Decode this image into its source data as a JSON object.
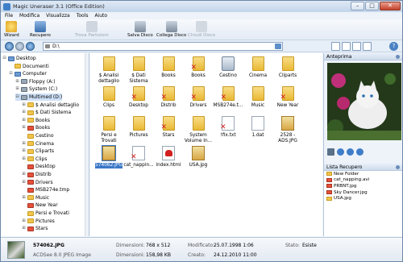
{
  "window": {
    "title": "Magic Uneraser 3.1 (Office Edition)"
  },
  "menu": [
    "File",
    "Modifica",
    "Visualizza",
    "Tools",
    "Aiuto"
  ],
  "toolbar": {
    "wizard": "Wizard",
    "recupero": "Recupero",
    "trova": "Trova Partizioni",
    "salva": "Salva Disco",
    "collega": "Collega Disco",
    "chiudi": "Chiudi Disco"
  },
  "address": {
    "path": "D:\\"
  },
  "tree": [
    {
      "label": "Desktop",
      "icon": "desktop-icon",
      "level": 0,
      "expander": "⊟"
    },
    {
      "label": "Documenti",
      "icon": "folder-icon",
      "level": 1,
      "expander": ""
    },
    {
      "label": "Computer",
      "icon": "computer-icon",
      "level": 1,
      "expander": "⊟"
    },
    {
      "label": "Floppy (A:)",
      "icon": "drive-icon",
      "level": 2,
      "expander": "⊞"
    },
    {
      "label": "System (C:)",
      "icon": "drive-icon",
      "level": 2,
      "expander": "⊞"
    },
    {
      "label": "Multimed (D:)",
      "icon": "drive-icon",
      "level": 2,
      "expander": "⊟",
      "selected": true
    },
    {
      "label": "$ Analisi dettaglio",
      "icon": "folder-icon",
      "level": 3,
      "expander": "⊞"
    },
    {
      "label": "$ Dati Sistema",
      "icon": "folder-icon",
      "level": 3,
      "expander": "⊞"
    },
    {
      "label": "Books",
      "icon": "folder-icon",
      "level": 3,
      "expander": "⊞"
    },
    {
      "label": "Books",
      "icon": "deleted-folder-icon",
      "level": 3,
      "expander": "⊞"
    },
    {
      "label": "Cestino",
      "icon": "folder-icon",
      "level": 3,
      "expander": ""
    },
    {
      "label": "Cinema",
      "icon": "folder-icon",
      "level": 3,
      "expander": "⊞"
    },
    {
      "label": "Cliparts",
      "icon": "folder-icon",
      "level": 3,
      "expander": "⊞"
    },
    {
      "label": "Clips",
      "icon": "folder-icon",
      "level": 3,
      "expander": "⊞"
    },
    {
      "label": "Desktop",
      "icon": "deleted-folder-icon",
      "level": 3,
      "expander": ""
    },
    {
      "label": "Distrib",
      "icon": "deleted-folder-icon",
      "level": 3,
      "expander": "⊞"
    },
    {
      "label": "Drivers",
      "icon": "deleted-folder-icon",
      "level": 3,
      "expander": "⊞"
    },
    {
      "label": "MSB274e.tmp",
      "icon": "deleted-folder-icon",
      "level": 3,
      "expander": ""
    },
    {
      "label": "Music",
      "icon": "folder-icon",
      "level": 3,
      "expander": "⊞"
    },
    {
      "label": "New Year",
      "icon": "deleted-folder-icon",
      "level": 3,
      "expander": ""
    },
    {
      "label": "Persi e Trovati",
      "icon": "folder-icon",
      "level": 3,
      "expander": ""
    },
    {
      "label": "Pictures",
      "icon": "folder-icon",
      "level": 3,
      "expander": "⊞"
    },
    {
      "label": "Stars",
      "icon": "deleted-folder-icon",
      "level": 3,
      "expander": "⊞"
    }
  ],
  "files": [
    {
      "label": "$ Analisi dettaglio",
      "kind": "folder",
      "deleted": false
    },
    {
      "label": "$ Dati Sistema",
      "kind": "folder",
      "deleted": false
    },
    {
      "label": "Books",
      "kind": "folder",
      "deleted": false
    },
    {
      "label": "Books",
      "kind": "folder",
      "deleted": true
    },
    {
      "label": "Cestino",
      "kind": "bin",
      "deleted": false
    },
    {
      "label": "Cinema",
      "kind": "folder",
      "deleted": false
    },
    {
      "label": "Cliparts",
      "kind": "folder",
      "deleted": false
    },
    {
      "label": "Clips",
      "kind": "folder",
      "deleted": false
    },
    {
      "label": "Desktop",
      "kind": "folder",
      "deleted": true
    },
    {
      "label": "Distrib",
      "kind": "folder",
      "deleted": true
    },
    {
      "label": "Drivers",
      "kind": "folder",
      "deleted": true
    },
    {
      "label": "MSB274e.t...",
      "kind": "folder",
      "deleted": true
    },
    {
      "label": "Music",
      "kind": "folder",
      "deleted": false
    },
    {
      "label": "New Year",
      "kind": "folder",
      "deleted": true
    },
    {
      "label": "Persi e Trovati",
      "kind": "folder",
      "deleted": false
    },
    {
      "label": "Pictures",
      "kind": "folder",
      "deleted": false
    },
    {
      "label": "Stars",
      "kind": "folder",
      "deleted": true
    },
    {
      "label": "System Volume In...",
      "kind": "folder",
      "deleted": false
    },
    {
      "label": "!fix.txt",
      "kind": "doc",
      "deleted": true
    },
    {
      "label": "1.dat",
      "kind": "doc",
      "deleted": false
    },
    {
      "label": "2528 - ADS.JPG",
      "kind": "img",
      "deleted": false
    },
    {
      "label": "574062.JPG",
      "kind": "img",
      "deleted": false,
      "selected": true
    },
    {
      "label": "cat_nappin...",
      "kind": "doc",
      "deleted": true
    },
    {
      "label": "index.html",
      "kind": "pdf",
      "deleted": false
    },
    {
      "label": "USA.jpg",
      "kind": "img",
      "deleted": false
    }
  ],
  "preview": {
    "title": "Anteprima"
  },
  "lista": {
    "title": "Lista Recupero",
    "items": [
      {
        "label": "New Folder",
        "icon": "folder-icon"
      },
      {
        "label": "cat_napping.avi",
        "icon": "deleted-file-icon"
      },
      {
        "label": "PRBNT.jpg",
        "icon": "deleted-file-icon"
      },
      {
        "label": "Sky Dancer.jpg",
        "icon": "deleted-file-icon"
      },
      {
        "label": "USA.jpg",
        "icon": "file-icon"
      }
    ]
  },
  "status": {
    "filename": "574062.JPG",
    "type": "ACDSee 8.0 JPEG Image",
    "dimensioni_label": "Dimensioni:",
    "dimensioni_px": "768 x 512",
    "dimensioni_kb": "158,98 KB",
    "modificato_label": "Modificato:",
    "modificato": "25.07.1998 1:06",
    "creato_label": "Creato:",
    "creato": "24.12.2010 11:00",
    "stato_label": "Stato:",
    "stato": "Esiste"
  }
}
